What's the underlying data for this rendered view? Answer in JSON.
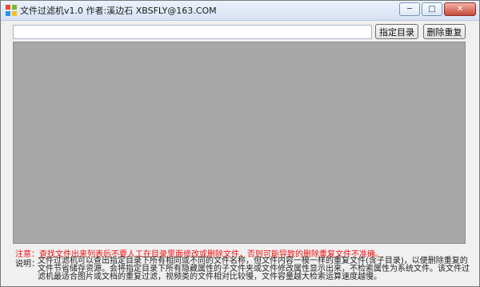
{
  "window": {
    "title": "文件过滤机v1.0   作者:溪边石  XBSFLY@163.COM",
    "icon": "app-window-icon",
    "controls": {
      "minimize": "─",
      "maximize": "□",
      "close": "✕"
    }
  },
  "toolbar": {
    "path_value": "",
    "select_dir_label": "指定目录",
    "delete_dup_label": "删除重复"
  },
  "list": {
    "color": "#a8a8a8"
  },
  "footer": {
    "warning": "注意：查找文件出来列表后不要人工在目录里面修改或删除文件，否则可能导致的删除重复文件不准确。",
    "note_label": "说明：",
    "note_text": "文件过滤机可以查出指定目录下所有相同或不同的文件名称，但文件内容一模一样的重复文件(含子目录)，以便删除重复的文件节省储存资源。会将指定目录下所有隐藏属性的子文件夹或文件修改属性显示出来，不检索属性为系统文件。该文件过滤机最适合图片或文档的重复过滤，视频类的文件相对比较慢，文件容量越大检索运算速度越慢。"
  }
}
